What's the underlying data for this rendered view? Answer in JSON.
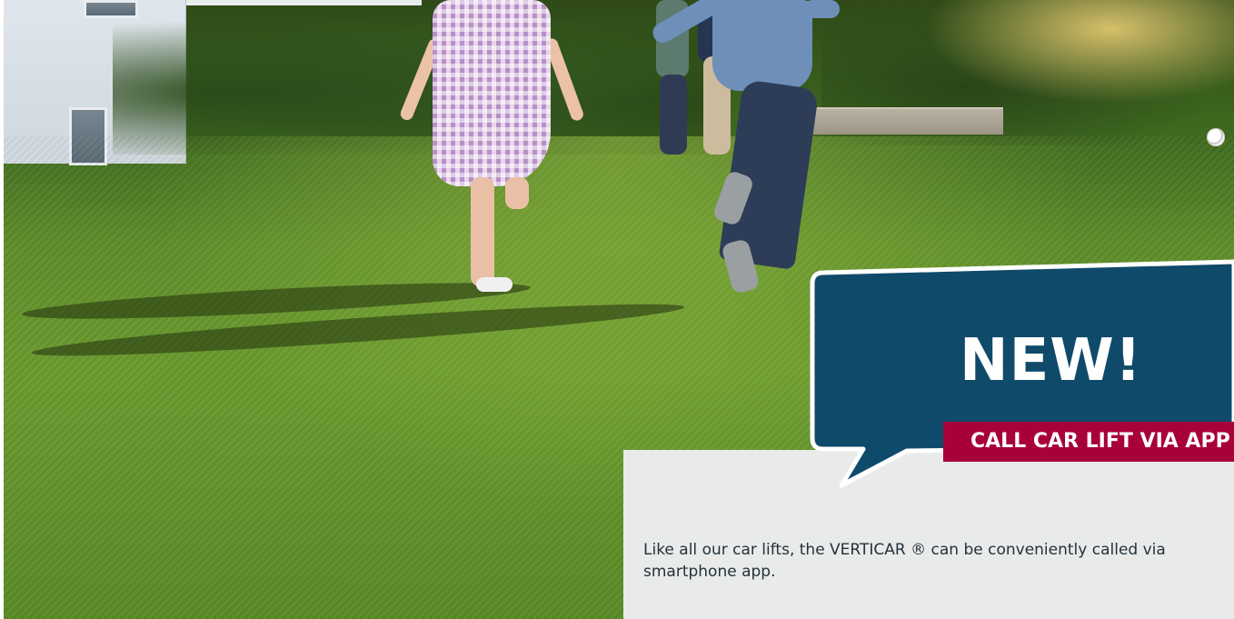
{
  "hero": {
    "image_description": "Children running across a green lawn in a garden"
  },
  "callout": {
    "badge": "NEW!",
    "banner": "CALL CAR LIFT VIA APP",
    "colors": {
      "bubble": "#0f4a6a",
      "banner": "#a8003a",
      "text": "#ffffff"
    }
  },
  "info": {
    "text": "Like all our car lifts, the VERTICAR ® can be conveniently called via smartphone app."
  }
}
